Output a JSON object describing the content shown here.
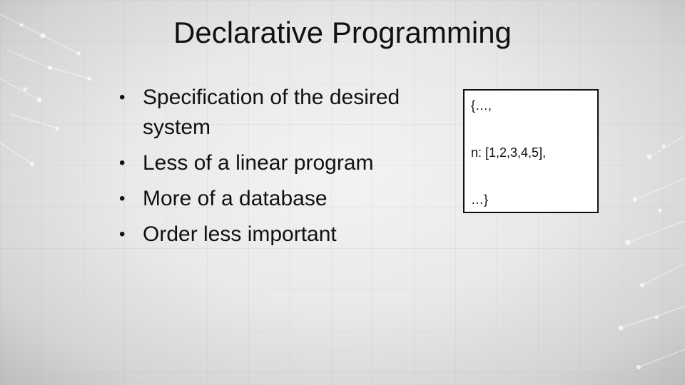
{
  "slide": {
    "title": "Declarative Programming",
    "bullets": [
      "Specification of the desired system",
      "Less of a linear program",
      "More of a database",
      "Order less important"
    ],
    "code_box": {
      "line1": "{…,",
      "line2": "n: [1,2,3,4,5],",
      "line3": "…}"
    }
  }
}
